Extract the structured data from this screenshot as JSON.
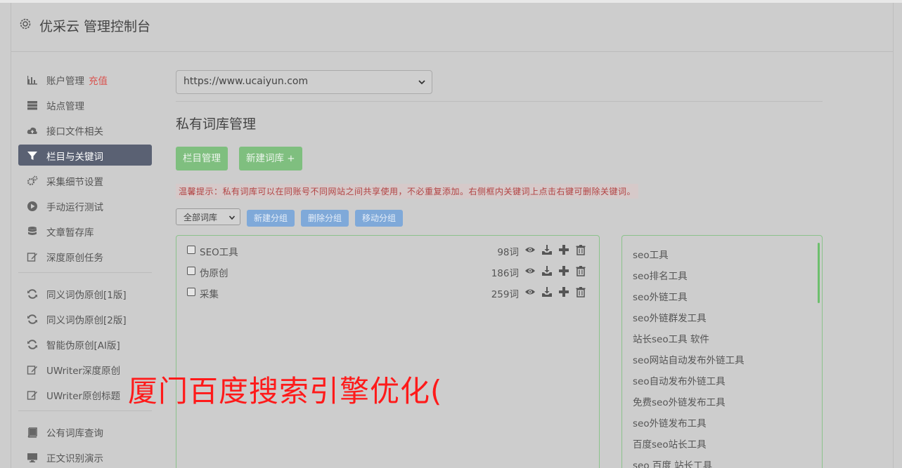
{
  "header": {
    "title": "优采云 管理控制台",
    "icon": "gear-icon"
  },
  "sidebar": {
    "group1": [
      {
        "label": "账户管理",
        "badge": "充值",
        "icon": "bar-chart-icon"
      },
      {
        "label": "站点管理",
        "icon": "server-icon"
      },
      {
        "label": "接口文件相关",
        "icon": "cloud-upload-icon"
      },
      {
        "label": "栏目与关键词",
        "icon": "filter-icon",
        "active": true
      },
      {
        "label": "采集细节设置",
        "icon": "gears-icon"
      },
      {
        "label": "手动运行测试",
        "icon": "play-icon"
      },
      {
        "label": "文章暂存库",
        "icon": "database-icon"
      },
      {
        "label": "深度原创任务",
        "icon": "edit-icon"
      }
    ],
    "group2": [
      {
        "label": "同义词伪原创[1版]",
        "icon": "refresh-icon"
      },
      {
        "label": "同义词伪原创[2版]",
        "icon": "refresh-icon"
      },
      {
        "label": "智能伪原创[AI版]",
        "icon": "refresh-icon"
      },
      {
        "label": "UWriter深度原创",
        "icon": "edit-icon"
      },
      {
        "label": "UWriter原创标题",
        "icon": "edit-icon"
      }
    ],
    "group3": [
      {
        "label": "公有词库查询",
        "icon": "book-icon"
      },
      {
        "label": "正文识别演示",
        "icon": "monitor-icon"
      }
    ]
  },
  "main": {
    "site_select": {
      "value": "https://www.ucaiyun.com"
    },
    "page_title": "私有词库管理",
    "buttons": {
      "column_manage": "栏目管理",
      "new_library": "新建词库 +"
    },
    "tip": "温馨提示：私有词库可以在同账号不同网站之间共享使用，不必重复添加。右侧框内关键词上点击右键可删除关键词。",
    "group_select": {
      "value": "全部词库"
    },
    "group_buttons": {
      "new_group": "新建分组",
      "delete_group": "删除分组",
      "move_group": "移动分组"
    },
    "libraries": [
      {
        "name": "SEO工具",
        "count": "98词"
      },
      {
        "name": "伪原创",
        "count": "186词"
      },
      {
        "name": "采集",
        "count": "259词"
      }
    ],
    "keywords": [
      "seo工具",
      "seo排名工具",
      "seo外链工具",
      "seo外链群发工具",
      "站长seo工具 软件",
      "seo网站自动发布外链工具",
      "seo自动发布外链工具",
      "免费seo外链发布工具",
      "seo外链发布工具",
      "百度seo站长工具",
      "seo 百度 站长工具"
    ]
  },
  "overlay": {
    "text": "厦门百度搜索引擎优化("
  },
  "colors": {
    "active_bg": "#5a6173",
    "green_btn": "#7fbf7f",
    "blue_btn": "#7fa9d9",
    "tip_text": "#b24343",
    "overlay_red": "#ff1a1a"
  }
}
